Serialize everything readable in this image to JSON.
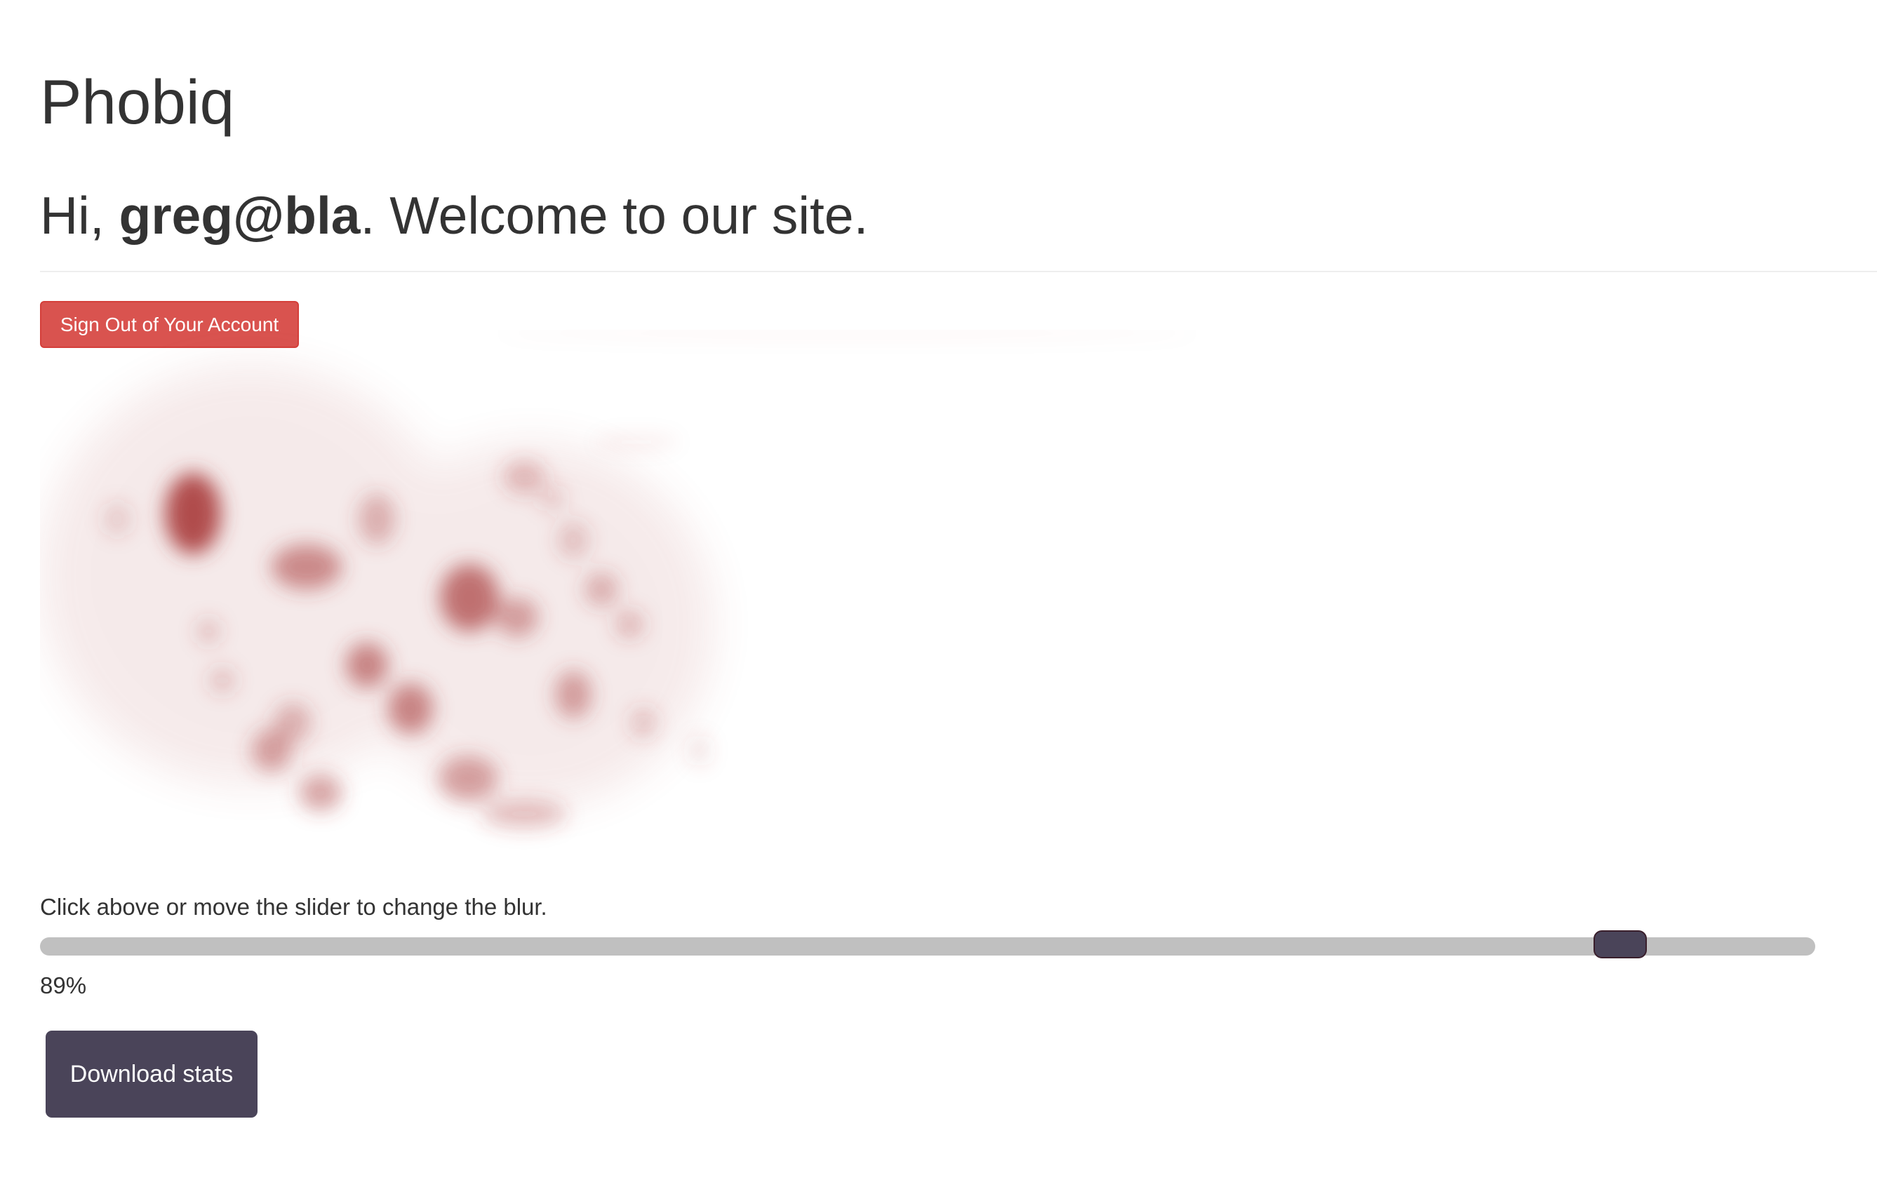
{
  "app": {
    "title": "Phobiq"
  },
  "welcome": {
    "greeting": "Hi, ",
    "username": "greg@bla",
    "message": ". Welcome to our site."
  },
  "account": {
    "signout_label": "Sign Out of Your Account"
  },
  "blur_control": {
    "instructions": "Click above or move the slider to change the blur.",
    "value_percent": 89,
    "value_label": "89%"
  },
  "actions": {
    "download_label": "Download stats"
  },
  "colors": {
    "danger": "#d9534f",
    "primary_dark": "#4a4459",
    "track": "#c0c0c0",
    "blob": "#a83a3a"
  }
}
